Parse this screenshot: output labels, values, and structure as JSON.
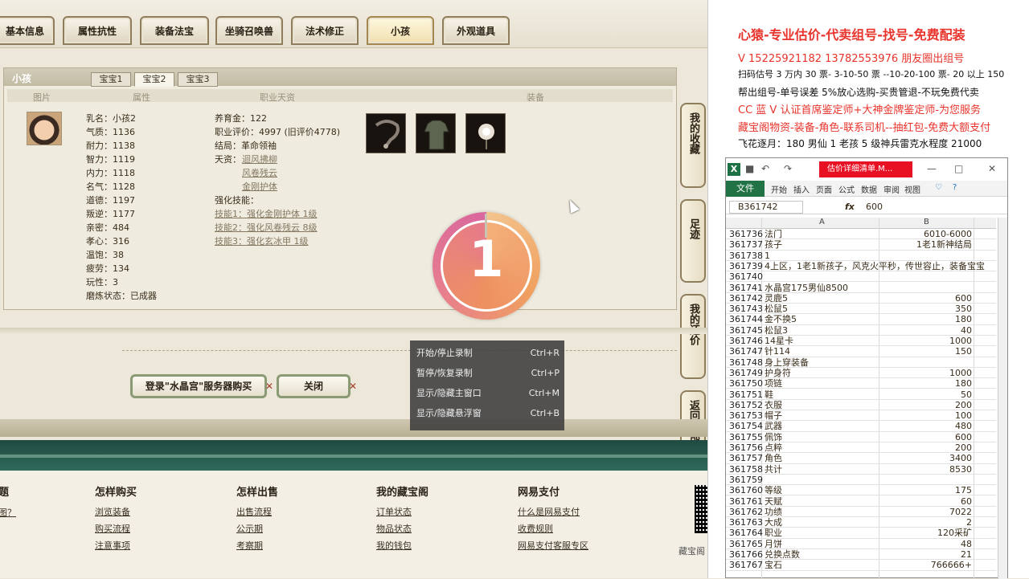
{
  "tabs": [
    "基本信息",
    "属性抗性",
    "装备法宝",
    "坐骑召唤兽",
    "法术修正",
    "小孩",
    "外观道具"
  ],
  "panel": {
    "title": "小孩",
    "subtabs": [
      "宝宝1",
      "宝宝2",
      "宝宝3"
    ],
    "columns": [
      "图片",
      "属性",
      "职业天资",
      "装备"
    ],
    "left_attrs": [
      "乳名：小孩2",
      "气质：1136",
      "耐力：1138",
      "智力：1119",
      "内力：1118",
      "名气：1128",
      "道德：1197",
      "叛逆：1177",
      "亲密：484",
      "孝心：316",
      "温饱：38",
      "疲劳：134",
      "玩性：3",
      "磨炼状态：已成器"
    ],
    "right_attrs": {
      "raise": "养育金：122",
      "score": "职业评价：4997 (旧评价4778)",
      "ending": "结局：革命领袖",
      "talent_label": "天资：",
      "talents": [
        "迴风拂柳",
        "风卷残云",
        "金刚护体"
      ],
      "skill_label": "强化技能：",
      "skills": [
        "技能1：强化金刚护体 1级",
        "技能2：强化风卷残云 8级",
        "技能3：强化玄冰甲 1级"
      ]
    }
  },
  "rightnav": [
    "我的收藏",
    "足迹",
    "我的还价",
    "返回顶部"
  ],
  "buttons": {
    "buy": "登录\"水晶宫\"服务器购买",
    "close": "关闭"
  },
  "countdown": "1",
  "ctx_menu": [
    {
      "label": "开始/停止录制",
      "key": "Ctrl+R"
    },
    {
      "label": "暂停/恢复录制",
      "key": "Ctrl+P"
    },
    {
      "label": "显示/隐藏主窗口",
      "key": "Ctrl+M"
    },
    {
      "label": "显示/隐藏悬浮窗",
      "key": "Ctrl+B"
    }
  ],
  "footer": {
    "cols": [
      {
        "title": "怎样购买",
        "links": [
          "浏览装备",
          "购买流程",
          "注意事项"
        ]
      },
      {
        "title": "怎样出售",
        "links": [
          "出售流程",
          "公示期",
          "考察期"
        ]
      },
      {
        "title": "我的藏宝阁",
        "links": [
          "订单状态",
          "物品状态",
          "我的钱包"
        ]
      },
      {
        "title": "网易支付",
        "links": [
          "什么是网易支付",
          "收费规则",
          "网易支付客服专区"
        ]
      }
    ],
    "partial_title": "题",
    "partial_link": "图？",
    "brand": "藏宝阁"
  },
  "ads": [
    "心猿-专业估价-代卖组号-找号-免费配装",
    "V 15225921182   13782553976 朋友圈出组号",
    "扫码估号 3 万内 30 票- 3-10-50 票  --10-20-100 票- 20 以上 150",
    "帮出组号-单号误差 5%放心选购-买贵管退-不玩免费代卖",
    "CC 蓝 V 认证首席鉴定师+大神金牌鉴定师-为您服务",
    "藏宝阁物资-装备-角色-联系司机--抽红包-免费大额支付",
    "飞花逐月：180 男仙 1 老孩 5 级神兵雷克水程度 21000"
  ],
  "excel": {
    "doc_title": "估价详细清单.M...",
    "menu": [
      "开始",
      "插入",
      "页面",
      "公式",
      "数据",
      "审阅",
      "视图"
    ],
    "file_tab": "文件",
    "namebox": "B361742",
    "formula": "600",
    "colA": "A",
    "colB": "B",
    "rows": [
      [
        "361736",
        "法门",
        "6010-6000"
      ],
      [
        "361737",
        "孩子",
        "1老1新神结局"
      ],
      [
        "361738",
        "1",
        ""
      ],
      [
        "361739",
        "4上区，1老1新孩子，风克火平秒，传世容止，装备宝宝",
        ""
      ],
      [
        "361740",
        "",
        ""
      ],
      [
        "361741",
        "水晶宫175男仙8500",
        ""
      ],
      [
        "361742",
        "灵鹿5",
        "600"
      ],
      [
        "361743",
        "松鼠5",
        "350"
      ],
      [
        "361744",
        "金不换5",
        "180"
      ],
      [
        "361745",
        "松鼠3",
        "40"
      ],
      [
        "361746",
        "14星卡",
        "1000"
      ],
      [
        "361747",
        "针114",
        "150"
      ],
      [
        "361748",
        "身上穿装备",
        ""
      ],
      [
        "361749",
        "护身符",
        "1000"
      ],
      [
        "361750",
        "项链",
        "180"
      ],
      [
        "361751",
        "鞋",
        "50"
      ],
      [
        "361752",
        "衣服",
        "200"
      ],
      [
        "361753",
        "帽子",
        "100"
      ],
      [
        "361754",
        "武器",
        "480"
      ],
      [
        "361755",
        "佩饰",
        "600"
      ],
      [
        "361756",
        "点粹",
        "200"
      ],
      [
        "361757",
        "角色",
        "3400"
      ],
      [
        "361758",
        "共计",
        "8530"
      ],
      [
        "361759",
        "",
        ""
      ],
      [
        "361760",
        "等级",
        "175"
      ],
      [
        "361761",
        "天赋",
        "60"
      ],
      [
        "361762",
        "功绩",
        "7022"
      ],
      [
        "361763",
        "大成",
        "2"
      ],
      [
        "361764",
        "职业",
        "120采矿"
      ],
      [
        "361765",
        "月饼",
        "48"
      ],
      [
        "361766",
        "兑换点数",
        "21"
      ],
      [
        "361767",
        "宝石",
        "766666+"
      ]
    ]
  }
}
